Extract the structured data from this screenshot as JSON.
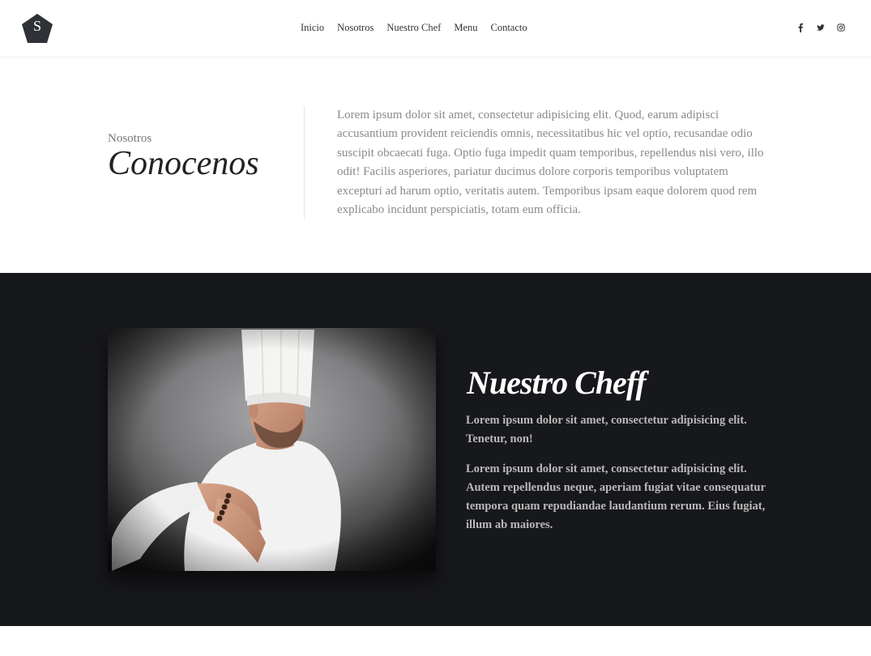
{
  "brand": {
    "logo_letter": "S"
  },
  "nav": {
    "items": [
      "Inicio",
      "Nosotros",
      "Nuestro Chef",
      "Menu",
      "Contacto"
    ]
  },
  "social": [
    "facebook-icon",
    "twitter-icon",
    "instagram-icon"
  ],
  "about": {
    "kicker": "Nosotros",
    "title": "Conocenos",
    "text": "Lorem ipsum dolor sit amet, consectetur adipisicing elit. Quod, earum adipisci accusantium provident reiciendis omnis, necessitatibus hic vel optio, recusandae odio suscipit obcaecati fuga. Optio fuga impedit quam temporibus, repellendus nisi vero, illo odit! Facilis asperiores, pariatur ducimus dolore corporis temporibus voluptatem excepturi ad harum optio, veritatis autem. Temporibus ipsam eaque dolorem quod rem explicabo incidunt perspiciatis, totam eum officia."
  },
  "chef": {
    "title": "Nuestro Cheff",
    "paragraph1": "Lorem ipsum dolor sit amet, consectetur adipisicing elit. Tenetur, non!",
    "paragraph2": "Lorem ipsum dolor sit amet, consectetur adipisicing elit. Autem repellendus neque, aperiam fugiat vitae consequatur tempora quam repudiandae laudantium rerum. Eius fugiat, illum ab maiores."
  },
  "colors": {
    "dark_section": "#17181b",
    "logo": "#2e3136",
    "text_muted": "#8a8a8a"
  }
}
